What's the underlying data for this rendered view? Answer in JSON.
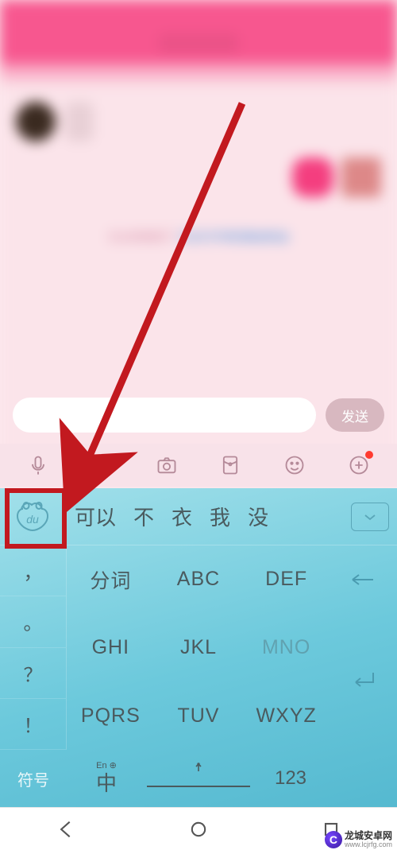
{
  "chat": {
    "send_label": "发送",
    "sys_text_left": "又从你收到了",
    "sys_text_link": "又云打开将您推送权益",
    "sys_text_right": ""
  },
  "toolbar": [
    "voice",
    "image",
    "camera",
    "red-envelope",
    "emoji",
    "add"
  ],
  "candidates": {
    "logo_label": "du",
    "items": [
      "可以",
      "不",
      "衣",
      "我",
      "没"
    ],
    "more_label": "▾"
  },
  "keyboard": {
    "punct_col": [
      "，",
      "。",
      "？",
      "！"
    ],
    "keys": [
      {
        "label": "分词"
      },
      {
        "label": "ABC"
      },
      {
        "label": "DEF"
      },
      {
        "label": "GHI"
      },
      {
        "label": "JKL"
      },
      {
        "label": "MNO",
        "dim": true
      },
      {
        "label": "PQRS"
      },
      {
        "label": "TUV"
      },
      {
        "label": "WXYZ"
      }
    ],
    "symbol_label": "符号",
    "lang_sup": "En ⊕",
    "lang_main": "中",
    "numeric_label": "123"
  },
  "watermark": {
    "line1": "龙城安卓网",
    "line2": "www.lcjrfg.com"
  }
}
